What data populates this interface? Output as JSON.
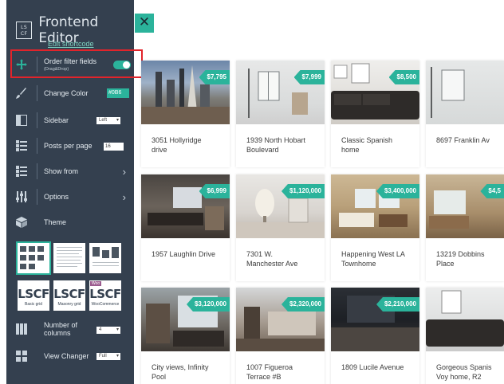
{
  "editor": {
    "logo_text": "LS\nCF",
    "title": "Frontend Editor",
    "close_label": "✕",
    "edit_shortcode": "Edit shortcode"
  },
  "menu": {
    "order_filter": {
      "label": "Order filter fields",
      "sub": "(Drag&Drop)",
      "toggle_on": true
    },
    "change_color": {
      "label": "Change Color",
      "value": "#0B6"
    },
    "sidebar": {
      "label": "Sidebar",
      "value": "Left"
    },
    "posts_per_page": {
      "label": "Posts per page",
      "value": "16"
    },
    "show_from": {
      "label": "Show from"
    },
    "options": {
      "label": "Options"
    },
    "theme": {
      "label": "Theme"
    },
    "columns": {
      "label": "Number of\ncolumns",
      "value": "4"
    },
    "view_changer": {
      "label": "View Changer",
      "value": "Full"
    }
  },
  "themes": [
    {
      "big": "LSCF",
      "caption": "Basic grid"
    },
    {
      "big": "LSCF",
      "caption": "Masonry grid"
    },
    {
      "big": "LSCF",
      "caption": "WooCommerce",
      "badge": "Woo"
    }
  ],
  "listings": [
    {
      "price": "$7,795",
      "title": "3051 Hollyridge\ndrive"
    },
    {
      "price": "$7,999",
      "title": "1939 North Hobart\nBoulevard"
    },
    {
      "price": "$8,500",
      "title": "Classic Spanish\nhome"
    },
    {
      "price": "",
      "title": "8697 Franklin Av"
    },
    {
      "price": "$6,999",
      "title": "1957 Laughlin Drive"
    },
    {
      "price": "$1,120,000",
      "title": "7301 W.\nManchester Ave"
    },
    {
      "price": "$3,400,000",
      "title": "Happening West LA\nTownhome"
    },
    {
      "price": "$4,5",
      "title": "13219 Dobbins\nPlace"
    },
    {
      "price": "$3,120,000",
      "title": "City views, Infinity\nPool"
    },
    {
      "price": "$2,320,000",
      "title": "1007 Figueroa\nTerrace #B"
    },
    {
      "price": "$2,210,000",
      "title": "1809 Lucile Avenue"
    },
    {
      "price": "",
      "title": "Gorgeous Spanis\nVoy home, R2"
    }
  ],
  "colors": {
    "sidebar_bg": "#34404f",
    "accent": "#2bb39b",
    "highlight": "#e1242b"
  }
}
